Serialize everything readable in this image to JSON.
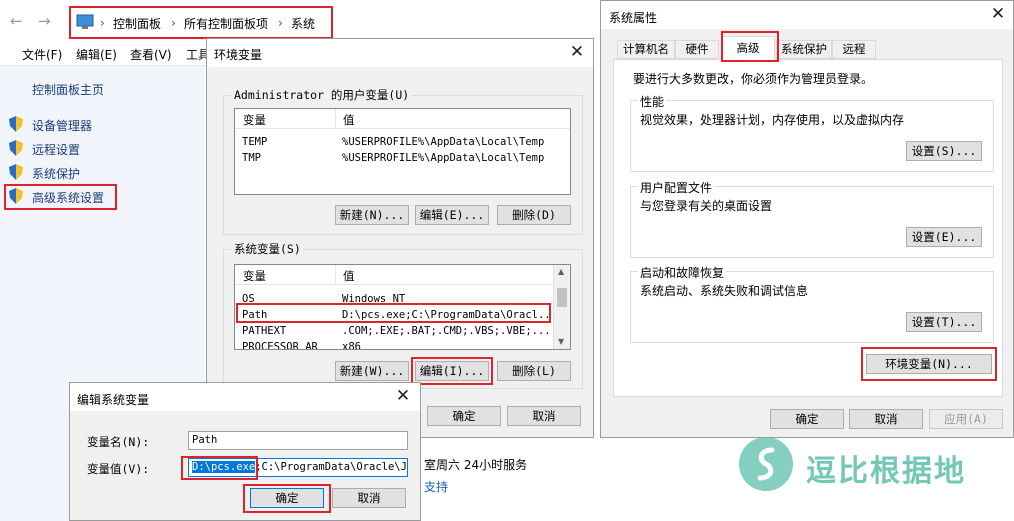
{
  "explorer": {
    "breadcrumb": [
      "控制面板",
      "所有控制面板项",
      "系统"
    ],
    "menu": [
      "文件(F)",
      "编辑(E)",
      "查看(V)",
      "工具"
    ],
    "sidebar": {
      "home": "控制面板主页",
      "items": [
        "设备管理器",
        "远程设置",
        "系统保护",
        "高级系统设置"
      ]
    },
    "bg_text": [
      "室周六 24小时服务",
      "支持"
    ]
  },
  "env_dialog": {
    "title": "环境变量",
    "user_group": "Administrator 的用户变量(U)",
    "user_headers": [
      "变量",
      "值"
    ],
    "user_vars": [
      {
        "name": "TEMP",
        "value": "%USERPROFILE%\\AppData\\Local\\Temp"
      },
      {
        "name": "TMP",
        "value": "%USERPROFILE%\\AppData\\Local\\Temp"
      }
    ],
    "user_buttons": [
      "新建(N)...",
      "编辑(E)...",
      "删除(D)"
    ],
    "sys_group": "系统变量(S)",
    "sys_headers": [
      "变量",
      "值"
    ],
    "sys_vars": [
      {
        "name": "OS",
        "value": "Windows_NT"
      },
      {
        "name": "Path",
        "value": "D:\\pcs.exe;C:\\ProgramData\\Oracl..."
      },
      {
        "name": "PATHEXT",
        "value": ".COM;.EXE;.BAT;.CMD;.VBS;.VBE;..."
      },
      {
        "name": "PROCESSOR_AR",
        "value": "x86"
      }
    ],
    "sys_buttons": [
      "新建(W)...",
      "编辑(I)...",
      "删除(L)"
    ],
    "ok": "确定",
    "cancel": "取消"
  },
  "edit_dialog": {
    "title": "编辑系统变量",
    "name_label": "变量名(N):",
    "name_value": "Path",
    "value_label": "变量值(V):",
    "value_selected": "D:\\pcs.exe",
    "value_rest": ";C:\\ProgramData\\Oracle\\Jav",
    "ok": "确定",
    "cancel": "取消"
  },
  "sysprops": {
    "title": "系统属性",
    "tabs": [
      "计算机名",
      "硬件",
      "高级",
      "系统保护",
      "远程"
    ],
    "admin_note": "要进行大多数更改，你必须作为管理员登录。",
    "perf_title": "性能",
    "perf_desc": "视觉效果，处理器计划，内存使用，以及虚拟内存",
    "perf_btn": "设置(S)...",
    "profile_title": "用户配置文件",
    "profile_desc": "与您登录有关的桌面设置",
    "profile_btn": "设置(E)...",
    "startup_title": "启动和故障恢复",
    "startup_desc": "系统启动、系统失败和调试信息",
    "startup_btn": "设置(T)...",
    "env_btn": "环境变量(N)...",
    "ok": "确定",
    "cancel": "取消",
    "apply": "应用(A)"
  },
  "watermark": {
    "text": "逗比根据地",
    "color": "#5bbfa9"
  }
}
